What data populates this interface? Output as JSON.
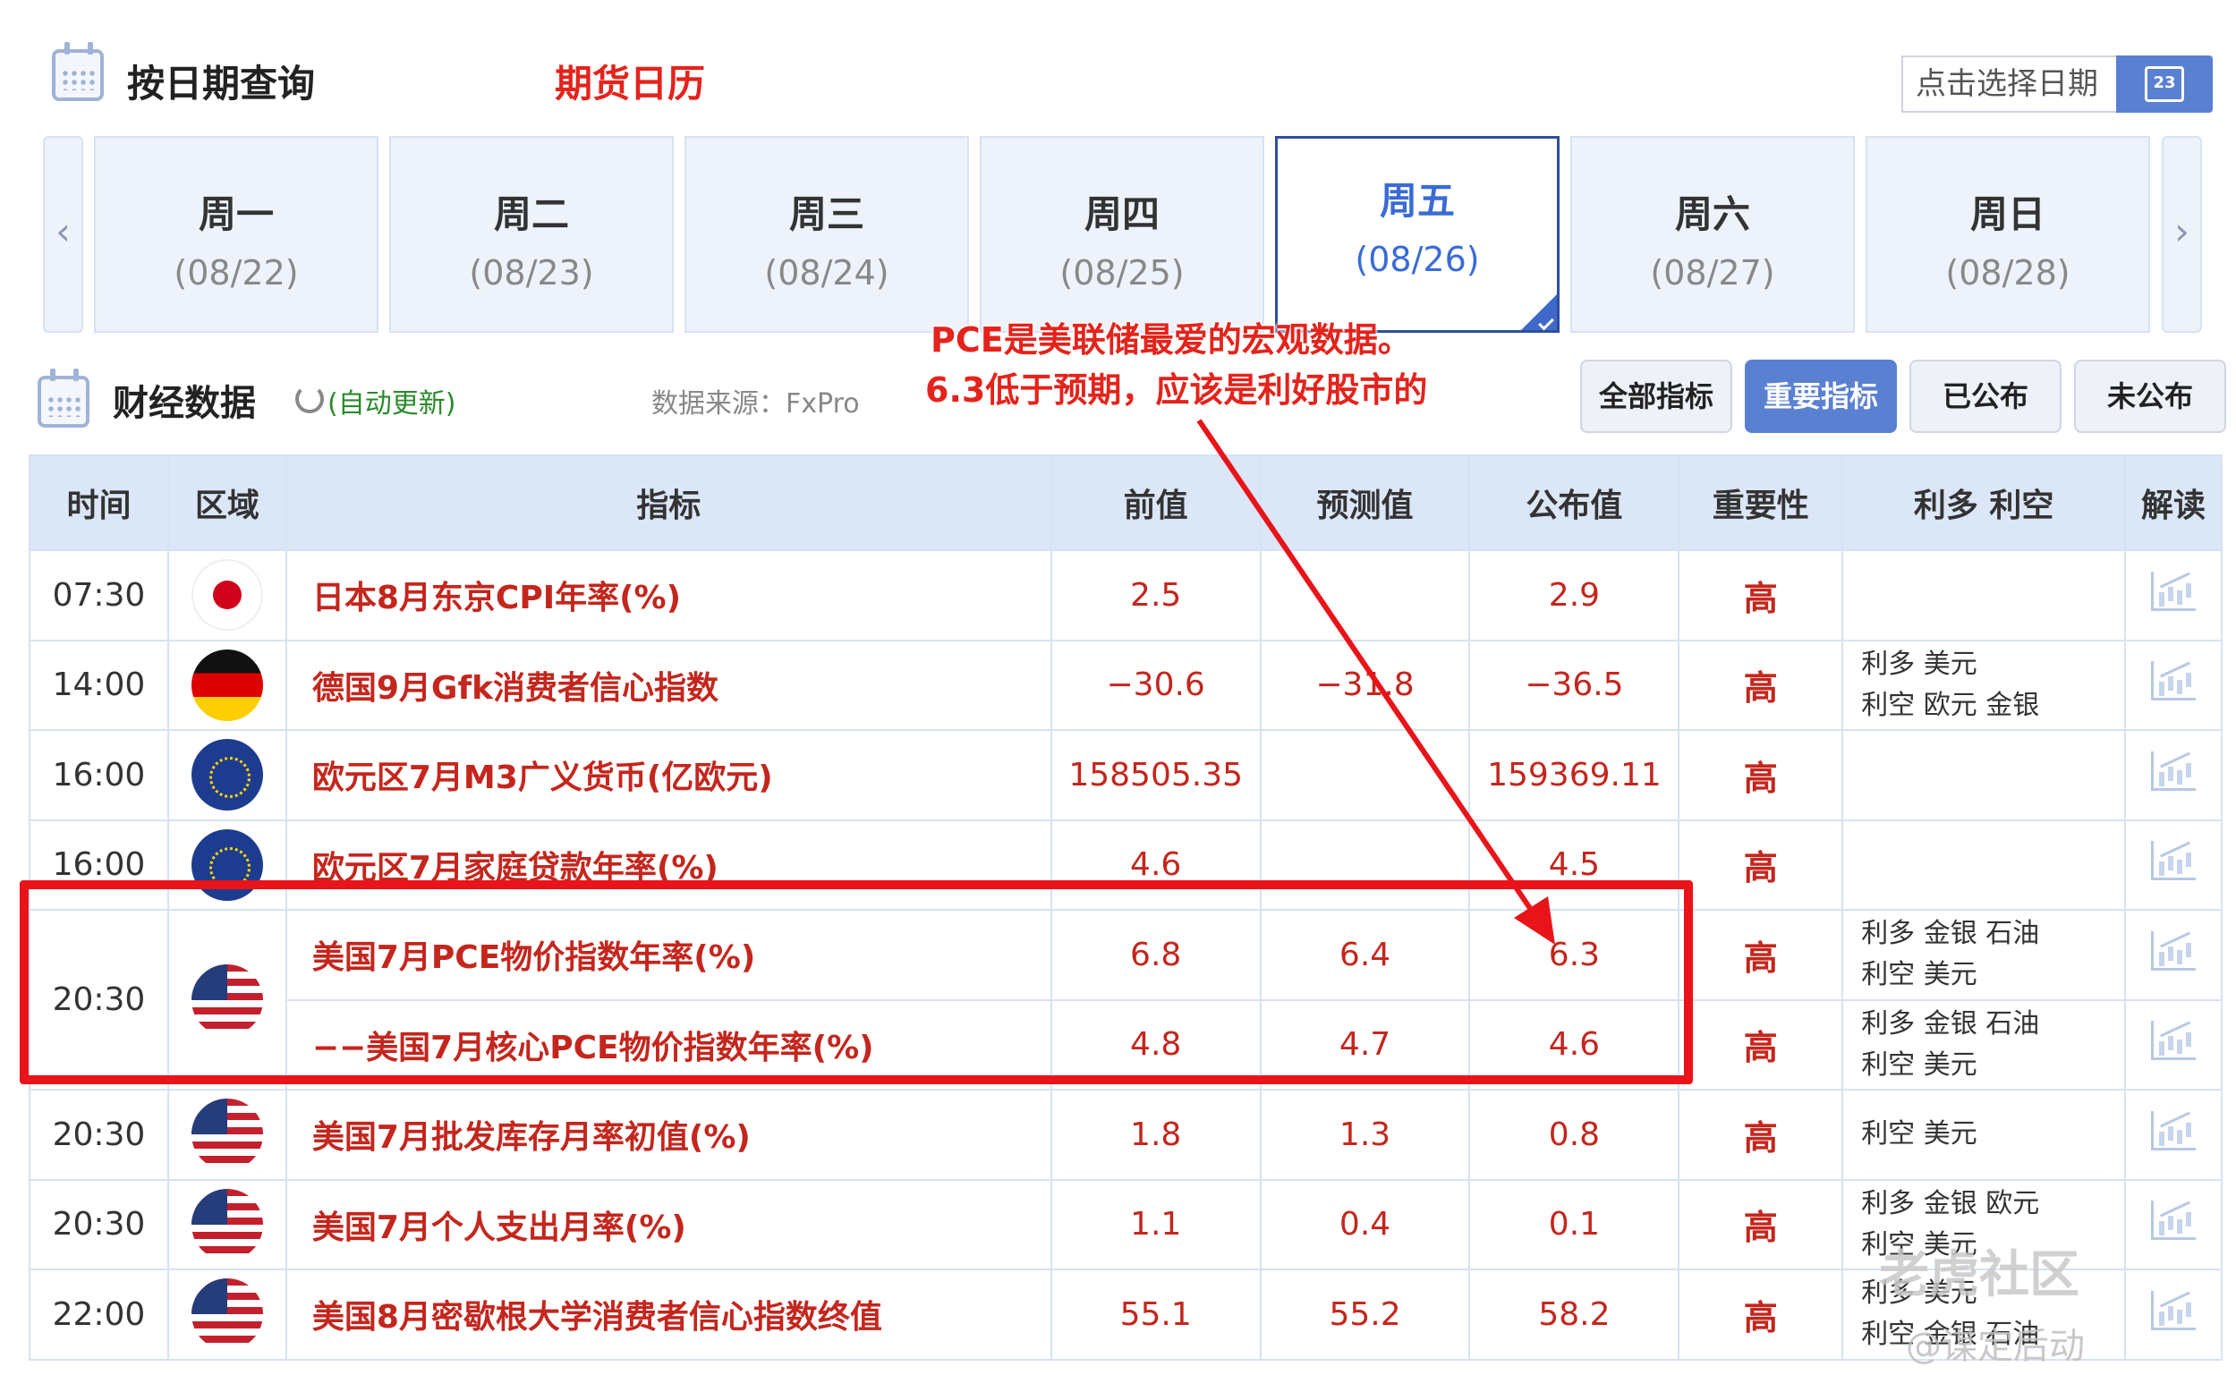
{
  "header": {
    "title": "按日期查询",
    "subtitle": "期货日历",
    "date_placeholder": "点击选择日期",
    "date_button_day": "23"
  },
  "week": {
    "prev": "‹",
    "next": "›",
    "days": [
      {
        "name": "周一",
        "date": "(08/22)"
      },
      {
        "name": "周二",
        "date": "(08/23)"
      },
      {
        "name": "周三",
        "date": "(08/24)"
      },
      {
        "name": "周四",
        "date": "(08/25)"
      },
      {
        "name": "周五",
        "date": "(08/26)",
        "active": true
      },
      {
        "name": "周六",
        "date": "(08/27)"
      },
      {
        "name": "周日",
        "date": "(08/28)"
      }
    ]
  },
  "section": {
    "title": "财经数据",
    "auto_update": "(自动更新)",
    "source": "数据来源：FxPro",
    "filters": [
      "全部指标",
      "重要指标",
      "已公布",
      "未公布"
    ],
    "active_filter": "重要指标"
  },
  "annotation": {
    "line1": "PCE是美联储最爱的宏观数据。",
    "line2": "6.3低于预期，应该是利好股市的"
  },
  "table": {
    "headers": [
      "时间",
      "区域",
      "指标",
      "前值",
      "预测值",
      "公布值",
      "重要性",
      "利多 利空",
      "解读"
    ],
    "rows": [
      {
        "time": "07:30",
        "flag": "jp",
        "indicator": "日本8月东京CPI年率(%)",
        "prev": "2.5",
        "forecast": "",
        "actual": "2.9",
        "importance": "高",
        "bull": "",
        "bear": ""
      },
      {
        "time": "14:00",
        "flag": "de",
        "indicator": "德国9月Gfk消费者信心指数",
        "prev": "−30.6",
        "forecast": "−31.8",
        "actual": "−36.5",
        "importance": "高",
        "bull": "利多  美元",
        "bear": "利空  欧元 金银"
      },
      {
        "time": "16:00",
        "flag": "eu",
        "indicator": "欧元区7月M3广义货币(亿欧元)",
        "prev": "158505.35",
        "forecast": "",
        "actual": "159369.11",
        "importance": "高",
        "bull": "",
        "bear": ""
      },
      {
        "time": "16:00",
        "flag": "eu",
        "indicator": "欧元区7月家庭贷款年率(%)",
        "prev": "4.6",
        "forecast": "",
        "actual": "4.5",
        "importance": "高",
        "bull": "",
        "bear": ""
      },
      {
        "time": "20:30",
        "flag": "us",
        "indicator": "美国7月PCE物价指数年率(%)",
        "prev": "6.8",
        "forecast": "6.4",
        "actual": "6.3",
        "importance": "高",
        "bull": "利多  金银 石油",
        "bear": "利空  美元"
      },
      {
        "time": "",
        "flag": "",
        "indicator": "−−美国7月核心PCE物价指数年率(%)",
        "prev": "4.8",
        "forecast": "4.7",
        "actual": "4.6",
        "importance": "高",
        "bull": "利多  金银 石油",
        "bear": "利空  美元"
      },
      {
        "time": "20:30",
        "flag": "us",
        "indicator": "美国7月批发库存月率初值(%)",
        "prev": "1.8",
        "forecast": "1.3",
        "actual": "0.8",
        "importance": "高",
        "bull": "",
        "bear": "利空  美元"
      },
      {
        "time": "20:30",
        "flag": "us",
        "indicator": "美国7月个人支出月率(%)",
        "prev": "1.1",
        "forecast": "0.4",
        "actual": "0.1",
        "importance": "高",
        "bull": "利多  金银 欧元",
        "bear": "利空  美元"
      },
      {
        "time": "22:00",
        "flag": "us",
        "indicator": "美国8月密歇根大学消费者信心指数终值",
        "prev": "55.1",
        "forecast": "55.2",
        "actual": "58.2",
        "importance": "高",
        "bull": "利多  美元",
        "bear": "利空  金银 石油"
      }
    ]
  },
  "watermark": {
    "main": "老虎社区",
    "handle": "@谋定后动"
  },
  "colors": {
    "accent_blue": "#5a80d2",
    "active_day_border": "#2d4f9c",
    "header_bg": "#dbe6f7",
    "value_red": "#c4261d",
    "highlight_red": "#e8141a",
    "positive_green": "#2a8a2a"
  }
}
